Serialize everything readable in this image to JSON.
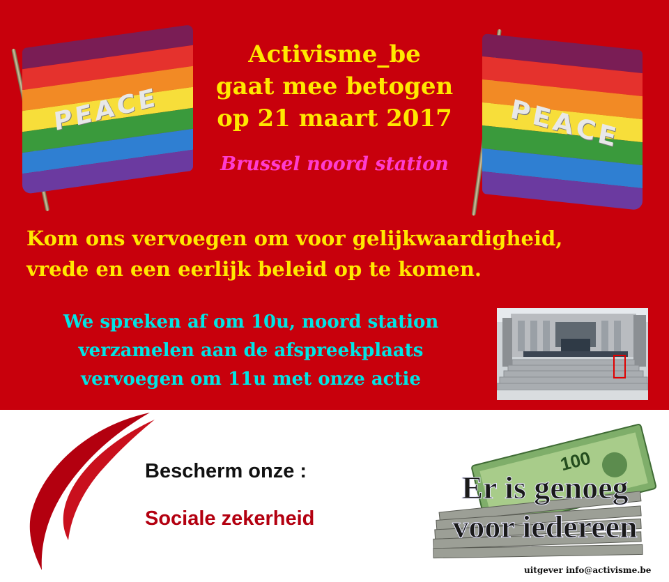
{
  "colors": {
    "background_top": "#c8000c",
    "headline": "#ffe800",
    "subtitle": "#ff3cd0",
    "meeting": "#00e5e5",
    "social": "#b30010"
  },
  "flags": {
    "left_text": "PEACE",
    "right_text": "PEACE"
  },
  "headline": {
    "line1": "Activisme_be",
    "line2": "gaat mee betogen",
    "line3": "op 21 maart 2017"
  },
  "subtitle": "Brussel noord station",
  "call_to_action": {
    "line1": "Kom ons vervoegen om voor gelijkwaardigheid,",
    "line2": "vrede en een eerlijk beleid op te komen."
  },
  "meeting": {
    "line1": "We spreken af om 10u, noord station",
    "line2": "verzamelen aan de afspreekplaats",
    "line3": "vervoegen om 11u met onze actie"
  },
  "bottom": {
    "protect": "Bescherm onze :",
    "social_security": "Sociale zekerheid"
  },
  "money_image": {
    "note_value": "100",
    "slogan_line1": "Er is genoeg",
    "slogan_line2": "voor iedereen"
  },
  "publisher": "uitgever info@activisme.be"
}
